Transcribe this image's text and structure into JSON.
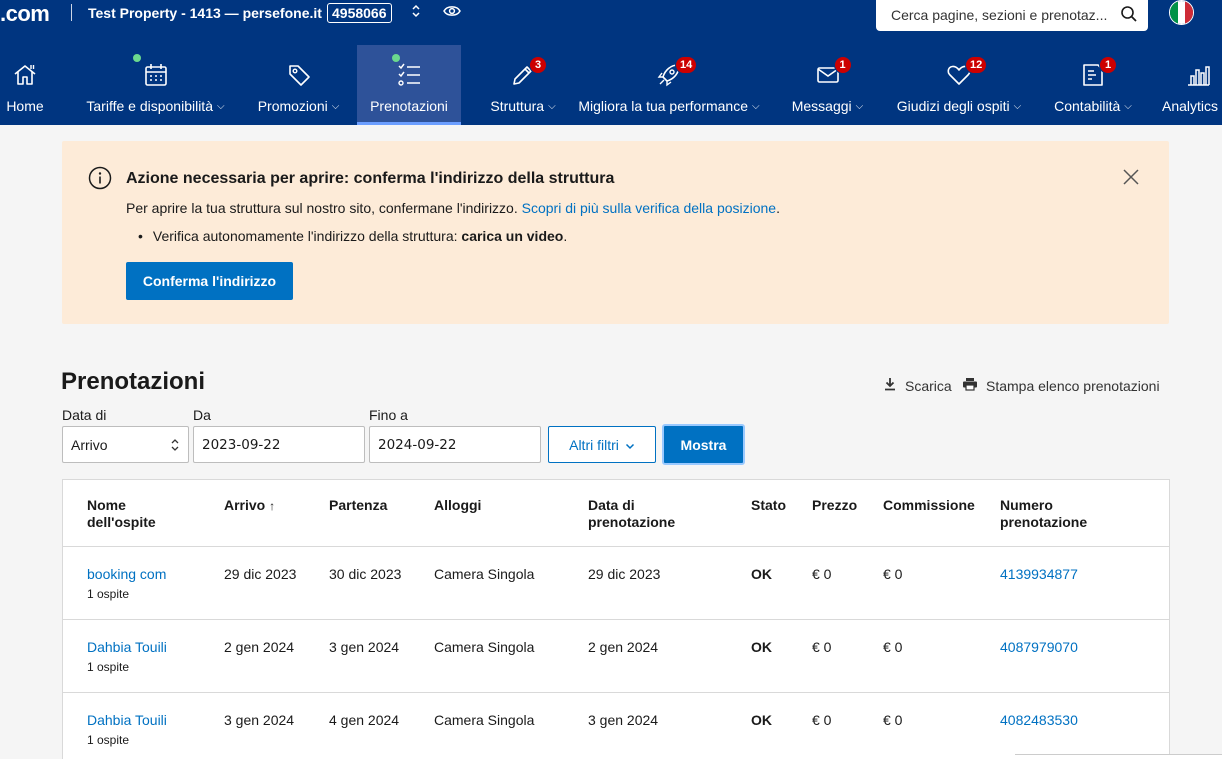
{
  "header": {
    "brand": ".com",
    "property_name": "Test Property - 1413 — persefone.it",
    "property_id": "4958066",
    "search_placeholder": "Cerca pagine, sezioni e prenotaz...",
    "flag_colors": [
      "#009246",
      "#ffffff",
      "#ce2b37"
    ]
  },
  "nav": [
    {
      "label": "Home",
      "icon": "home-icon",
      "badge": "",
      "dot": false,
      "caret": false
    },
    {
      "label": "Tariffe e disponibilità",
      "icon": "calendar-icon",
      "badge": "",
      "dot": true,
      "caret": true
    },
    {
      "label": "Promozioni",
      "icon": "tag-icon",
      "badge": "",
      "dot": false,
      "caret": true
    },
    {
      "label": "Prenotazioni",
      "icon": "list-icon",
      "badge": "",
      "dot": true,
      "caret": false,
      "active": true
    },
    {
      "label": "Struttura",
      "icon": "pencil-icon",
      "badge": "3",
      "dot": false,
      "caret": true
    },
    {
      "label": "Migliora la tua performance",
      "icon": "rocket-icon",
      "badge": "14",
      "dot": false,
      "caret": true
    },
    {
      "label": "Messaggi",
      "icon": "envelope-icon",
      "badge": "1",
      "dot": false,
      "caret": true
    },
    {
      "label": "Giudizi degli ospiti",
      "icon": "heart-icon",
      "badge": "12",
      "dot": false,
      "caret": true
    },
    {
      "label": "Contabilità",
      "icon": "document-icon",
      "badge": "1",
      "dot": false,
      "caret": true
    },
    {
      "label": "Analytics",
      "icon": "bar-chart-icon",
      "badge": "",
      "dot": false,
      "caret": false
    }
  ],
  "alert": {
    "title": "Azione necessaria per aprire: conferma l'indirizzo della struttura",
    "body": "Per aprire la tua struttura sul nostro sito, confermane l'indirizzo. ",
    "link": "Scopri di più sulla verifica della posizione",
    "body_end": ".",
    "bullet_text": "Verifica autonomamente l'indirizzo della struttura: ",
    "bullet_bold": "carica un video",
    "bullet_end": ".",
    "button": "Conferma l'indirizzo"
  },
  "reservations": {
    "title": "Prenotazioni",
    "download": "Scarica",
    "print": "Stampa elenco prenotazioni",
    "filters": {
      "date_of_label": "Data di",
      "date_of_value": "Arrivo",
      "from_label": "Da",
      "from_value": "2023-09-22",
      "to_label": "Fino a",
      "to_value": "2024-09-22",
      "more_filters": "Altri filtri",
      "show": "Mostra"
    },
    "columns": [
      "Nome dell'ospite",
      "Arrivo",
      "Partenza",
      "Alloggi",
      "Data di prenotazione",
      "Stato",
      "Prezzo",
      "Commissione",
      "Numero prenotazione"
    ],
    "sort_indicator": "↑",
    "rows": [
      {
        "guest": "booking com",
        "guests_count": "1 ospite",
        "arrival": "29 dic 2023",
        "departure": "30 dic 2023",
        "room": "Camera Singola",
        "booked": "29 dic 2023",
        "status": "OK",
        "price": "€ 0",
        "commission": "€ 0",
        "number": "4139934877"
      },
      {
        "guest": "Dahbia Touili",
        "guests_count": "1 ospite",
        "arrival": "2 gen 2024",
        "departure": "3 gen 2024",
        "room": "Camera Singola",
        "booked": "2 gen 2024",
        "status": "OK",
        "price": "€ 0",
        "commission": "€ 0",
        "number": "4087979070"
      },
      {
        "guest": "Dahbia Touili",
        "guests_count": "1 ospite",
        "arrival": "3 gen 2024",
        "departure": "4 gen 2024",
        "room": "Camera Singola",
        "booked": "3 gen 2024",
        "status": "OK",
        "price": "€ 0",
        "commission": "€ 0",
        "number": "4082483530"
      }
    ]
  }
}
